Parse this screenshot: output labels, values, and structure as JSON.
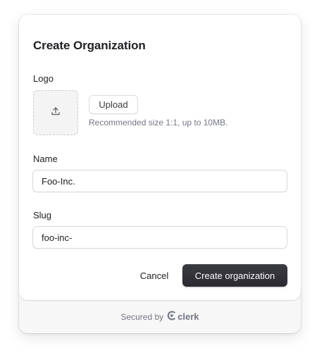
{
  "dialog": {
    "title": "Create Organization",
    "logo_label": "Logo",
    "upload_label": "Upload",
    "upload_hint": "Recommended size 1:1, up to 10MB.",
    "name_label": "Name",
    "name_value": "Foo-Inc.",
    "slug_label": "Slug",
    "slug_value": "foo-inc-",
    "cancel_label": "Cancel",
    "create_label": "Create organization"
  },
  "footer": {
    "secured_by": "Secured by",
    "brand": "clerk"
  },
  "icons": {
    "logo_placeholder": "upload-icon",
    "brand_mark": "clerk-logo-icon"
  },
  "colors": {
    "primary_button": "#2f2f35",
    "muted_text": "#747686",
    "footer_bg": "#f7f7f7"
  }
}
